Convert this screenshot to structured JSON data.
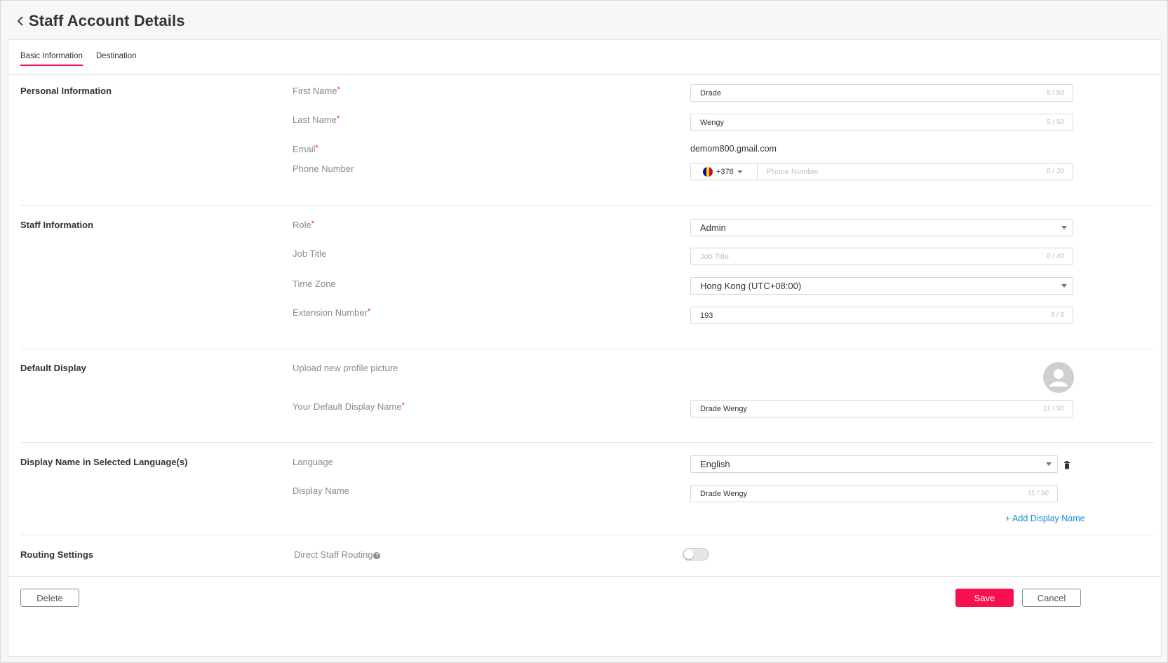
{
  "header": {
    "title": "Staff Account Details"
  },
  "tabs": [
    {
      "label": "Basic Information"
    },
    {
      "label": "Destination"
    }
  ],
  "personal": {
    "title": "Personal Information",
    "first_name_label": "First Name",
    "first_name_value": "Drade",
    "first_name_count": "5 / 50",
    "last_name_label": "Last Name",
    "last_name_value": "Wengy",
    "last_name_count": "5 / 50",
    "email_label": "Email",
    "email_value": "demom800.gmail.com",
    "phone_label": "Phone Number",
    "phone_country_code": "+376",
    "phone_placeholder": "Phone Number",
    "phone_count": "0 / 20"
  },
  "staff": {
    "title": "Staff Information",
    "role_label": "Role",
    "role_value": "Admin",
    "job_title_label": "Job Title",
    "job_title_placeholder": "Job Title",
    "job_title_count": "0 / 40",
    "timezone_label": "Time Zone",
    "timezone_value": "Hong Kong (UTC+08:00)",
    "extension_label": "Extension Number",
    "extension_value": "193",
    "extension_count": "3 / 6"
  },
  "default_display": {
    "title": "Default Display",
    "upload_label": "Upload new profile picture",
    "display_name_label": "Your Default Display Name",
    "display_name_value": "Drade Wengy",
    "display_name_count": "11 / 50"
  },
  "languages": {
    "title": "Display Name in Selected Language(s)",
    "language_label": "Language",
    "language_value": "English",
    "display_name_label": "Display Name",
    "display_name_value": "Drade Wengy",
    "display_name_count": "11 / 50",
    "add_link": "+ Add Display Name"
  },
  "routing": {
    "title": "Routing Settings",
    "direct_label": "Direct Staff Routing",
    "direct_enabled": false
  },
  "footer": {
    "delete_label": "Delete",
    "save_label": "Save",
    "cancel_label": "Cancel"
  },
  "colors": {
    "accent": "#f7114f",
    "link": "#1a8bd2"
  },
  "required_mark": "*"
}
